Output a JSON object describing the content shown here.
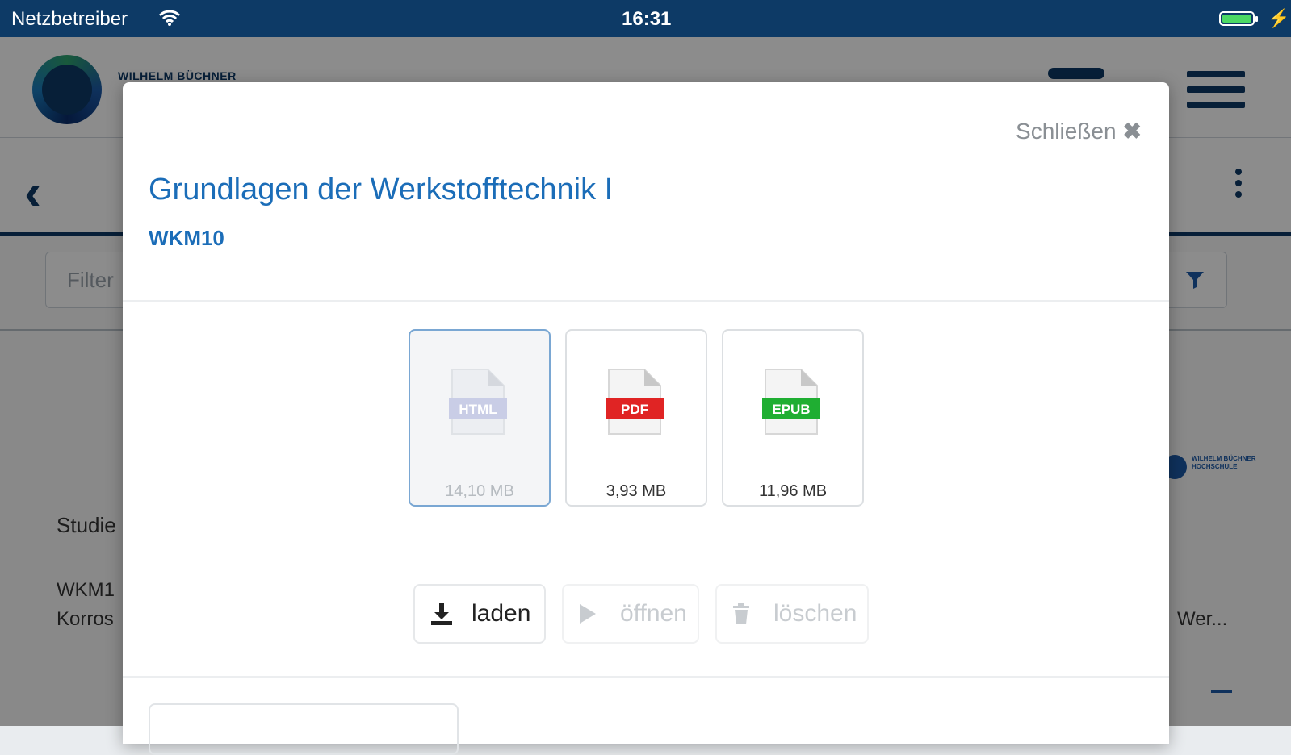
{
  "status_bar": {
    "carrier": "Netzbetreiber",
    "wifi_icon": "wifi-icon",
    "time": "16:31",
    "battery_icon": "battery-icon",
    "charging_icon": "bolt-icon"
  },
  "background": {
    "brand": "WILHELM BÜCHNER",
    "filter_placeholder": "Filter",
    "studie_label": "Studie",
    "row_code": "WKM1",
    "row_text": "Korros",
    "row_right": "Wer...",
    "menu_icon": "hamburger-icon",
    "back_icon": "chevron-left-icon",
    "more_icon": "kebab-icon",
    "filter_icon": "filter-icon"
  },
  "modal": {
    "close_label": "Schließen",
    "close_icon": "close-icon",
    "title": "Grundlagen der Werkstofftechnik I",
    "subtitle": "WKM10",
    "formats": [
      {
        "label": "HTML",
        "size": "14,10 MB",
        "selected": true,
        "color": "#c9cde6"
      },
      {
        "label": "PDF",
        "size": "3,93 MB",
        "selected": false,
        "color": "#e02424"
      },
      {
        "label": "EPUB",
        "size": "11,96 MB",
        "selected": false,
        "color": "#1fae32"
      }
    ],
    "actions": [
      {
        "label": "laden",
        "icon": "download-icon",
        "enabled": true
      },
      {
        "label": "öffnen",
        "icon": "play-icon",
        "enabled": false
      },
      {
        "label": "löschen",
        "icon": "trash-icon",
        "enabled": false
      }
    ]
  },
  "colors": {
    "status_bar": "#0d3a66",
    "accent": "#1b6db8",
    "overlay": "rgba(0,0,0,0.45)"
  }
}
